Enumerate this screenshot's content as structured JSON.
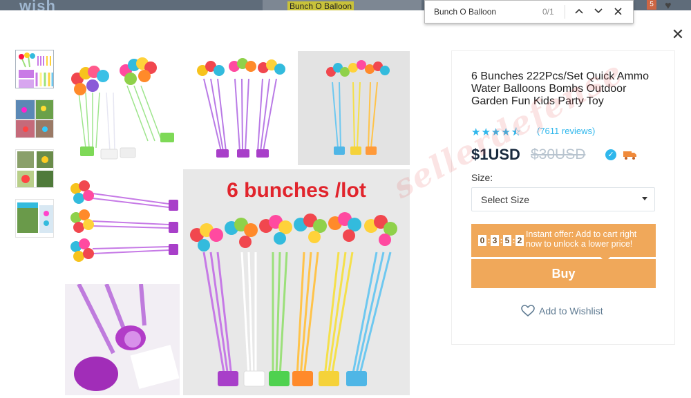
{
  "background": {
    "logo": "wish",
    "search_value": "Bunch O Balloon",
    "cart_count": "5",
    "heart_icon": "heart-icon"
  },
  "find_bar": {
    "query": "Bunch O Balloon",
    "count": "0/1",
    "prev_icon": "chevron-up-icon",
    "next_icon": "chevron-down-icon",
    "close_icon": "close-icon"
  },
  "close_icon": "close-icon",
  "main_image": {
    "banner_text": "6 bunches /lot"
  },
  "thumbnails": [
    {
      "name": "thumb-1"
    },
    {
      "name": "thumb-2"
    },
    {
      "name": "thumb-3"
    },
    {
      "name": "thumb-4"
    }
  ],
  "product": {
    "title": "6 Bunches 222Pcs/Set Quick Ammo Water Balloons Bombs Outdoor Garden Fun Kids Party Toy",
    "rating_stars": "★★★★⯪",
    "reviews": "(7611 reviews)",
    "price": "$1USD",
    "old_price": "$30USD",
    "size_label": "Size:",
    "size_select": "Select Size",
    "offer_timer": [
      "0",
      "3",
      "5",
      "2"
    ],
    "offer_text": "Instant offer: Add to cart right now to unlock a lower price!",
    "buy_label": "Buy",
    "wishlist_label": "Add to Wishlist"
  },
  "watermark": "sellerdefense",
  "colors": {
    "accent_orange": "#f0a85a",
    "link_blue": "#2fb7ec",
    "price_dark": "#192a3e"
  }
}
